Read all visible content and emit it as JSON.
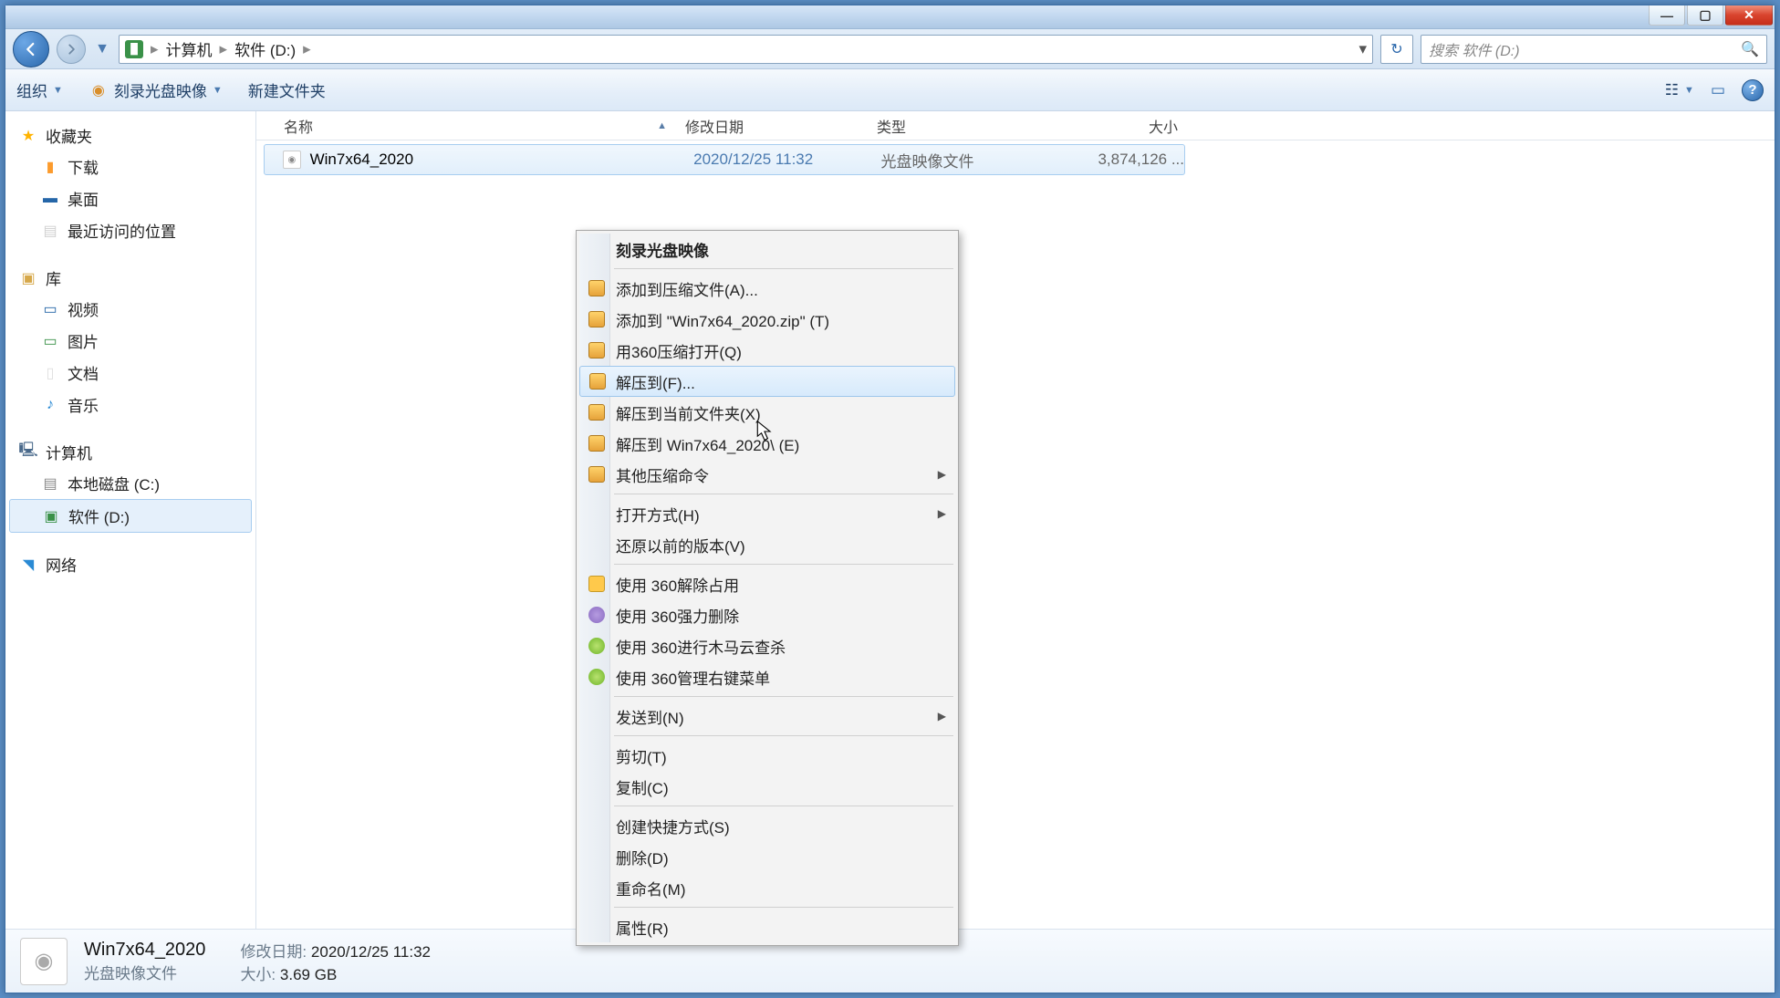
{
  "titlebar": {
    "min": "—",
    "max": "▢",
    "close": "✕"
  },
  "nav": {
    "crumb1": "计算机",
    "crumb2": "软件 (D:)"
  },
  "search_placeholder": "搜索 软件 (D:)",
  "toolbar": {
    "organize": "组织",
    "burn": "刻录光盘映像",
    "newfolder": "新建文件夹"
  },
  "sidebar": {
    "fav": "收藏夹",
    "downloads": "下载",
    "desktop": "桌面",
    "recent": "最近访问的位置",
    "lib": "库",
    "video": "视频",
    "pic": "图片",
    "doc": "文档",
    "music": "音乐",
    "computer": "计算机",
    "cdrive": "本地磁盘 (C:)",
    "ddrive": "软件 (D:)",
    "network": "网络"
  },
  "columns": {
    "name": "名称",
    "date": "修改日期",
    "type": "类型",
    "size": "大小"
  },
  "file": {
    "name": "Win7x64_2020",
    "date": "2020/12/25 11:32",
    "type": "光盘映像文件",
    "size": "3,874,126 ..."
  },
  "details": {
    "name": "Win7x64_2020",
    "type": "光盘映像文件",
    "date_label": "修改日期:",
    "date": "2020/12/25 11:32",
    "size_label": "大小:",
    "size": "3.69 GB"
  },
  "ctx": {
    "burn": "刻录光盘映像",
    "add_archive": "添加到压缩文件(A)...",
    "add_zip": "添加到 \"Win7x64_2020.zip\" (T)",
    "open_360": "用360压缩打开(Q)",
    "extract_to": "解压到(F)...",
    "extract_here": "解压到当前文件夹(X)",
    "extract_folder": "解压到 Win7x64_2020\\ (E)",
    "other_compress": "其他压缩命令",
    "open_with": "打开方式(H)",
    "restore_prev": "还原以前的版本(V)",
    "unlock_360": "使用 360解除占用",
    "force_del_360": "使用 360强力删除",
    "scan_360": "使用 360进行木马云查杀",
    "menu_360": "使用 360管理右键菜单",
    "send_to": "发送到(N)",
    "cut": "剪切(T)",
    "copy": "复制(C)",
    "shortcut": "创建快捷方式(S)",
    "delete": "删除(D)",
    "rename": "重命名(M)",
    "properties": "属性(R)"
  }
}
